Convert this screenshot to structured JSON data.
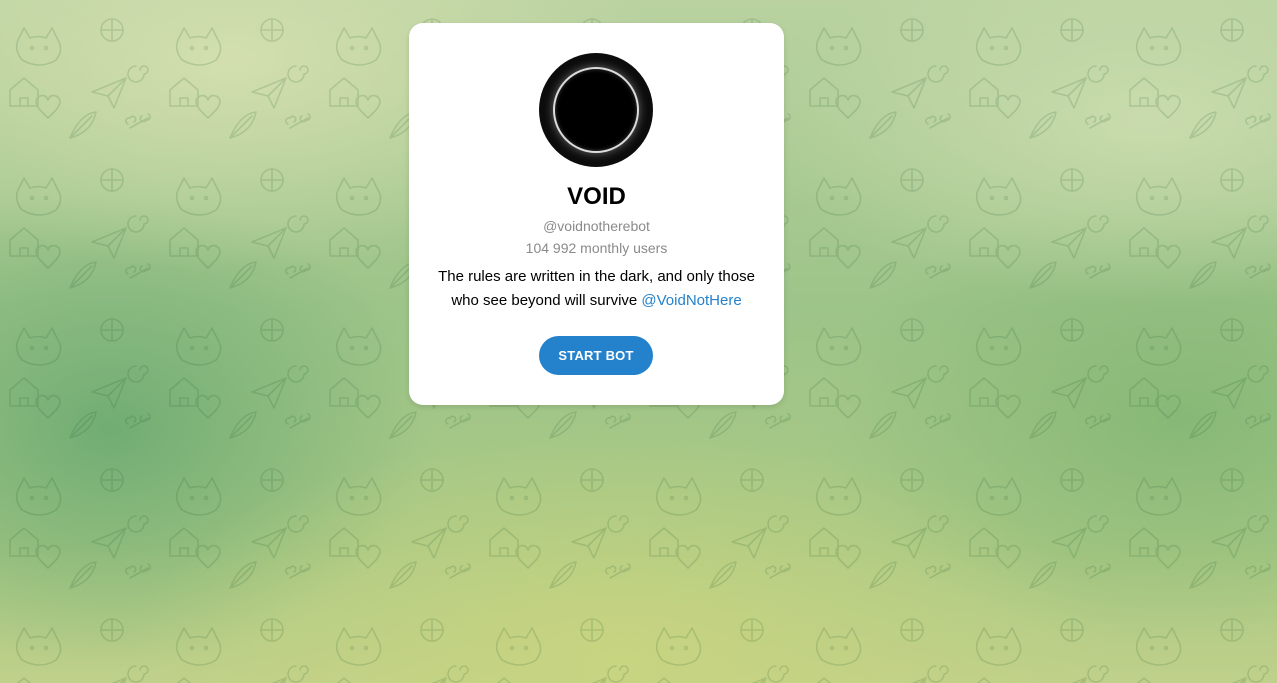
{
  "bot": {
    "name": "VOID",
    "username": "@voidnotherebot",
    "monthly_users": "104 992 monthly users",
    "description_text": "The rules are written in the dark, and only those who see beyond will survive ",
    "description_link": "@VoidNotHere",
    "avatar_icon": "void-circle-avatar"
  },
  "actions": {
    "start_label": "START BOT"
  },
  "colors": {
    "accent": "#2481cc",
    "muted_text": "#8a8a8a",
    "card_bg": "#ffffff"
  },
  "background": {
    "icon": "doodle-pattern"
  }
}
